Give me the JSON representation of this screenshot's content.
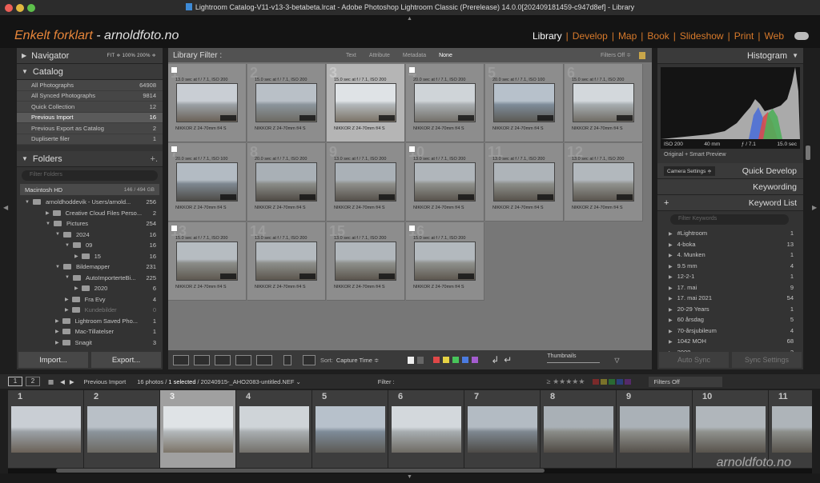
{
  "window": {
    "title": "Lightroom Catalog-V11-v13-3-betabeta.lrcat - Adobe Photoshop Lightroom Classic (Prerelease) 14.0.0[202409181459-c947d8ef] - Library"
  },
  "brand": {
    "name": "Enkelt forklart",
    "site": "- arnoldfoto.no"
  },
  "modules": [
    "Library",
    "Develop",
    "Map",
    "Book",
    "Slideshow",
    "Print",
    "Web"
  ],
  "active_module": "Library",
  "navigator": {
    "title": "Navigator",
    "sizes": "FIT ≑  100%  200% ≑"
  },
  "catalog": {
    "title": "Catalog",
    "items": [
      {
        "label": "All Photographs",
        "count": "64908"
      },
      {
        "label": "All Synced Photographs",
        "count": "9814"
      },
      {
        "label": "Quick Collection",
        "count": "12"
      },
      {
        "label": "Previous Import",
        "count": "16"
      },
      {
        "label": "Previous Export as Catalog",
        "count": "2"
      },
      {
        "label": "Dupliserte filer",
        "count": "1"
      }
    ]
  },
  "folders": {
    "title": "Folders",
    "search_placeholder": "Filter Folders",
    "volume": "Macintosh HD",
    "volume_info": "146 / 494 GB",
    "items": [
      {
        "label": "arnoldhoddevik - Users/arnold...",
        "count": "256"
      },
      {
        "label": "Creative Cloud Files Perso...",
        "count": "2"
      },
      {
        "label": "Pictures",
        "count": "254"
      },
      {
        "label": "2024",
        "count": "16"
      },
      {
        "label": "09",
        "count": "16"
      },
      {
        "label": "15",
        "count": "16"
      },
      {
        "label": "Bildemapper",
        "count": "231"
      },
      {
        "label": "AutoImporterteBi...",
        "count": "225"
      },
      {
        "label": "2020",
        "count": "6"
      },
      {
        "label": "Fra Evy",
        "count": "4"
      },
      {
        "label": "Kundebilder",
        "count": "0"
      },
      {
        "label": "Lightroom Saved Pho...",
        "count": "1"
      },
      {
        "label": "Mac-Tillatelser",
        "count": "1"
      },
      {
        "label": "Snagit",
        "count": "3"
      }
    ]
  },
  "left_buttons": {
    "import": "Import...",
    "export": "Export..."
  },
  "library_filter": {
    "title": "Library Filter :",
    "options": [
      "Text",
      "Attribute",
      "Metadata",
      "None"
    ],
    "active": "None",
    "filters": "Filters Off ≑"
  },
  "photos": [
    {
      "n": "1",
      "exif": "13.0 sec at f / 7.1, ISO 200",
      "lens": "NIKKOR Z 24-70mm f/4 S"
    },
    {
      "n": "2",
      "exif": "15.0 sec at f / 7.1, ISO 200",
      "lens": "NIKKOR Z 24-70mm f/4 S"
    },
    {
      "n": "3",
      "exif": "15.0 sec at f / 7.1, ISO 200",
      "lens": "NIKKOR Z 24-70mm f/4 S"
    },
    {
      "n": "4",
      "exif": "20.0 sec at f / 7.1, ISO 200",
      "lens": "NIKKOR Z 24-70mm f/4 S"
    },
    {
      "n": "5",
      "exif": "20.0 sec at f / 7.1, ISO 100",
      "lens": "NIKKOR Z 24-70mm f/4 S"
    },
    {
      "n": "6",
      "exif": "15.0 sec at f / 7.1, ISO 200",
      "lens": "NIKKOR Z 24-70mm f/4 S"
    },
    {
      "n": "7",
      "exif": "20.0 sec at f / 7.1, ISO 100",
      "lens": "NIKKOR Z 24-70mm f/4 S"
    },
    {
      "n": "8",
      "exif": "20.0 sec at f / 7.1, ISO 200",
      "lens": "NIKKOR Z 24-70mm f/4 S"
    },
    {
      "n": "9",
      "exif": "13.0 sec at f / 7.1, ISO 200",
      "lens": "NIKKOR Z 24-70mm f/4 S"
    },
    {
      "n": "10",
      "exif": "13.0 sec at f / 7.1, ISO 200",
      "lens": "NIKKOR Z 24-70mm f/4 S"
    },
    {
      "n": "11",
      "exif": "13.0 sec at f / 7.1, ISO 200",
      "lens": "NIKKOR Z 24-70mm f/4 S"
    },
    {
      "n": "12",
      "exif": "13.0 sec at f / 7.1, ISO 200",
      "lens": "NIKKOR Z 24-70mm f/4 S"
    },
    {
      "n": "13",
      "exif": "15.0 sec at f / 7.1, ISO 200",
      "lens": "NIKKOR Z 24-70mm f/4 S"
    },
    {
      "n": "14",
      "exif": "13.0 sec at f / 7.1, ISO 200",
      "lens": "NIKKOR Z 24-70mm f/4 S"
    },
    {
      "n": "15",
      "exif": "13.0 sec at f / 7.1, ISO 200",
      "lens": "NIKKOR Z 24-70mm f/4 S"
    },
    {
      "n": "16",
      "exif": "15.0 sec at f / 7.1, ISO 200",
      "lens": "NIKKOR Z 24-70mm f/4 S"
    }
  ],
  "selected_photo": "3",
  "toolbar": {
    "sort_label": "Sort:",
    "sort_value": "Capture Time ≑",
    "thumbnails": "Thumbnails"
  },
  "histogram": {
    "title": "Histogram",
    "iso": "ISO 200",
    "focal": "40 mm",
    "aperture": "ƒ / 7.1",
    "shutter": "15.0 sec",
    "preview": "Original + Smart Preview"
  },
  "right_panels": {
    "camera_settings": "Camera Settings ≑",
    "quick_develop": "Quick Develop",
    "keywording": "Keywording",
    "keyword_list": "Keyword List",
    "kw_placeholder": "Filter Keywords"
  },
  "keywords": [
    {
      "label": "#Lightroom",
      "count": "1"
    },
    {
      "label": "4-boka",
      "count": "13"
    },
    {
      "label": "4. Munken",
      "count": "1"
    },
    {
      "label": "9.5 mm",
      "count": "4"
    },
    {
      "label": "12-2-1",
      "count": "1"
    },
    {
      "label": "17. mai",
      "count": "9"
    },
    {
      "label": "17. mai 2021",
      "count": "54"
    },
    {
      "label": "20-29 Years",
      "count": "1"
    },
    {
      "label": "60 årsdag",
      "count": "5"
    },
    {
      "label": "70-årsjubileum",
      "count": "4"
    },
    {
      "label": "1042 MOH",
      "count": "68"
    },
    {
      "label": "2008",
      "count": "2"
    }
  ],
  "right_buttons": {
    "auto_sync": "Auto Sync",
    "sync": "Sync Settings"
  },
  "filmstrip_bar": {
    "s1": "1",
    "s2": "2",
    "source": "Previous Import",
    "count": "16 photos /",
    "selected": "1 selected",
    "file": "/ 20240915-_AHO2083-untitled.NEF ⌄",
    "filter": "Filter :",
    "filters_off": "Filters Off"
  },
  "filmstrip": [
    "1",
    "2",
    "3",
    "4",
    "5",
    "6",
    "7",
    "8",
    "9",
    "10",
    "11"
  ],
  "watermark": "arnoldfoto.no",
  "colors": {
    "accent": "#d87a2b",
    "panel": "#333333",
    "grid_bg": "#777777"
  }
}
